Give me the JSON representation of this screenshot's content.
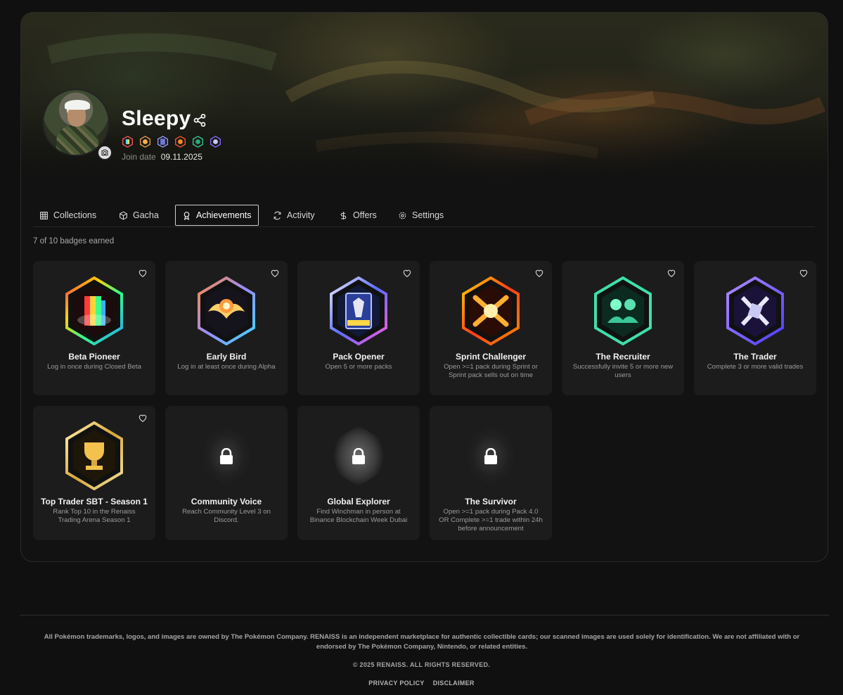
{
  "profile": {
    "name": "Sleepy",
    "join_label": "Join date",
    "join_date": "09.11.2025",
    "mini_badge_count": 6
  },
  "tabs": [
    {
      "label": "Collections",
      "icon": "grid-icon",
      "active": false
    },
    {
      "label": "Gacha",
      "icon": "box-icon",
      "active": false
    },
    {
      "label": "Achievements",
      "icon": "award-icon",
      "active": true
    },
    {
      "label": "Activity",
      "icon": "refresh-icon",
      "active": false
    },
    {
      "label": "Offers",
      "icon": "dollar-icon",
      "active": false
    },
    {
      "label": "Settings",
      "icon": "gear-icon",
      "active": false
    }
  ],
  "achievements": {
    "count_text": "7 of 10 badges earned",
    "badges": [
      {
        "title": "Beta Pioneer",
        "desc": "Log in once during Closed Beta",
        "earned": true,
        "theme": "rainbow"
      },
      {
        "title": "Early Bird",
        "desc": "Log in at least once during Alpha",
        "earned": true,
        "theme": "bird"
      },
      {
        "title": "Pack Opener",
        "desc": "Open 5 or more packs",
        "earned": true,
        "theme": "pack"
      },
      {
        "title": "Sprint Challenger",
        "desc": "Open >=1 pack during Sprint or Sprint pack sells out on time",
        "earned": true,
        "theme": "fire"
      },
      {
        "title": "The Recruiter",
        "desc": "Successfully invite 5 or more new users",
        "earned": true,
        "theme": "green"
      },
      {
        "title": "The Trader",
        "desc": "Complete 3 or more valid trades",
        "earned": true,
        "theme": "purple"
      },
      {
        "title": "Top Trader SBT - Season 1",
        "desc": "Rank Top 10 in the Renaiss Trading Arena Season 1",
        "earned": true,
        "theme": "gold"
      },
      {
        "title": "Community Voice",
        "desc": "Reach Community Level 3 on Discord.",
        "earned": false,
        "theme": "locked"
      },
      {
        "title": "Global Explorer",
        "desc": "Find Winchman in person at Binance Blockchain Week Dubai",
        "earned": false,
        "theme": "locked-light"
      },
      {
        "title": "The Survivor",
        "desc": "Open >=1 pack during Pack 4.0 OR Complete >=1 trade within 24h before announcement",
        "earned": false,
        "theme": "locked"
      }
    ]
  },
  "footer": {
    "note": "All Pokémon trademarks, logos, and images are owned by The Pokémon Company. RENAISS is an independent marketplace for authentic collectible cards; our scanned images are used solely for identification. We are not affiliated with or endorsed by The Pokémon Company, Nintendo, or related entities.",
    "copyright": "© 2025 RENAISS. ALL RIGHTS RESERVED.",
    "links": [
      "PRIVACY POLICY",
      "DISCLAIMER"
    ]
  },
  "colors": {
    "background": "#101010",
    "card": "#1c1c1c",
    "accent_rainbow": "#ff3d6e",
    "accent_green": "#35d29a",
    "accent_purple": "#8a6cff",
    "accent_gold": "#f2c14e"
  }
}
